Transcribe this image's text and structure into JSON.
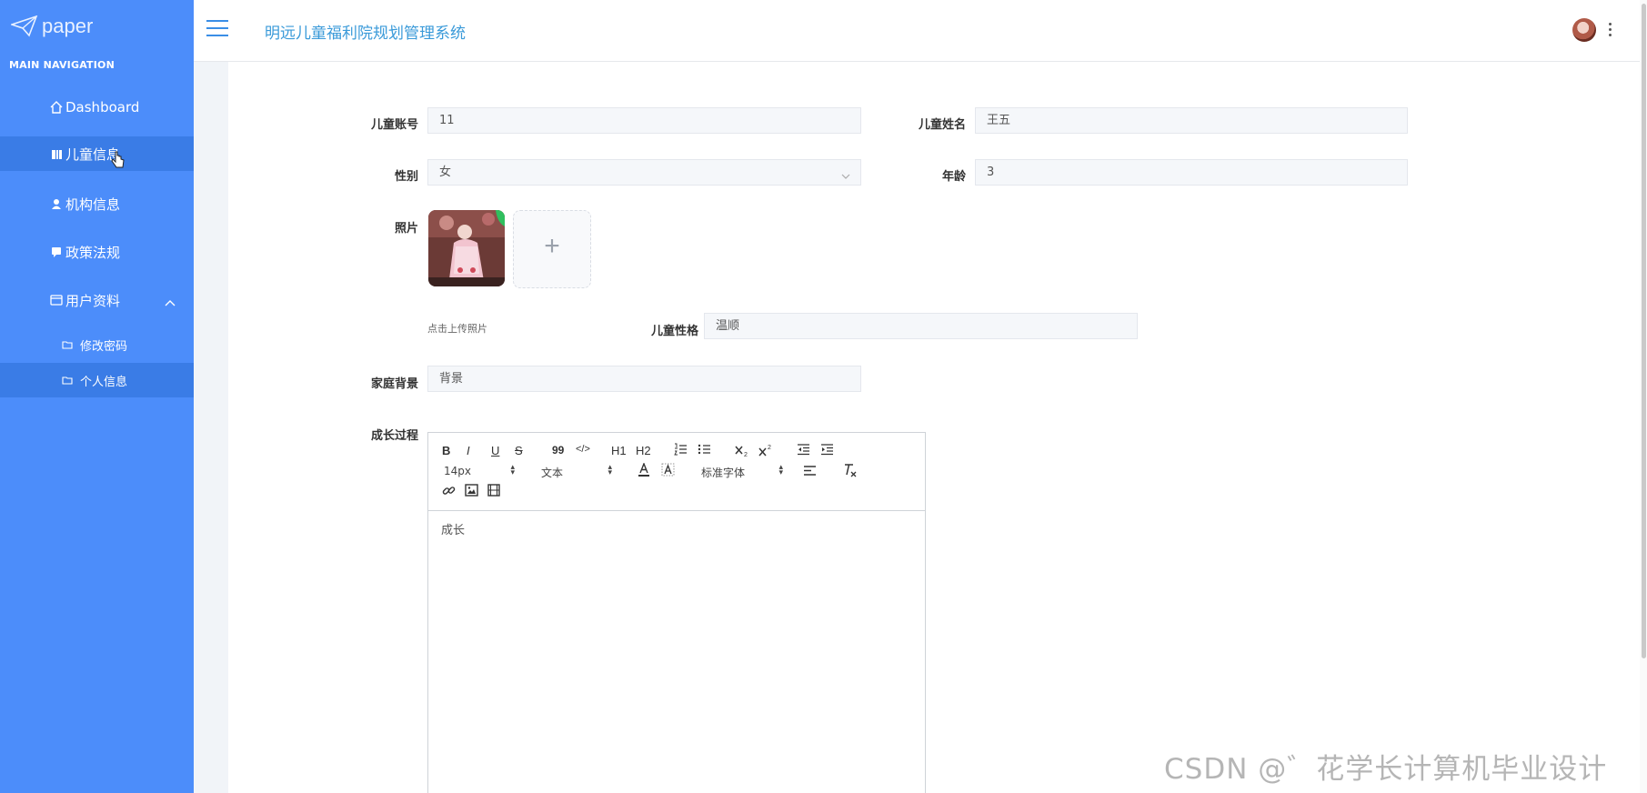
{
  "brand": {
    "logo_text": "paper"
  },
  "nav": {
    "heading": "MAIN NAVIGATION",
    "items": [
      {
        "label": "Dashboard",
        "icon": "home-icon"
      },
      {
        "label": "儿童信息",
        "icon": "book-icon"
      },
      {
        "label": "机构信息",
        "icon": "user-icon"
      },
      {
        "label": "政策法规",
        "icon": "chat-icon"
      },
      {
        "label": "用户资料",
        "icon": "card-icon"
      }
    ],
    "sub_items": [
      {
        "label": "修改密码",
        "icon": "folder-icon"
      },
      {
        "label": "个人信息",
        "icon": "folder-icon"
      }
    ]
  },
  "header": {
    "title": "明远儿童福利院规划管理系统"
  },
  "form": {
    "account_label": "儿童账号",
    "account_value": "11",
    "name_label": "儿童姓名",
    "name_value": "王五",
    "gender_label": "性别",
    "gender_value": "女",
    "age_label": "年龄",
    "age_value": "3",
    "photo_label": "照片",
    "upload_hint": "点击上传照片",
    "upload_plus": "+",
    "personality_label": "儿童性格",
    "personality_value": "温顺",
    "family_label": "家庭背景",
    "family_value": "背景",
    "growth_label": "成长过程"
  },
  "editor": {
    "toolbar": {
      "bold": "B",
      "italic": "I",
      "underline": "U",
      "strike": "S",
      "quote": "99",
      "code": "</>",
      "h1": "H1",
      "h2": "H2",
      "size": "14px",
      "text_type": "文本",
      "font": "标准字体"
    },
    "content": "成长"
  },
  "watermark": "CSDN @゛花学长计算机毕业设计"
}
